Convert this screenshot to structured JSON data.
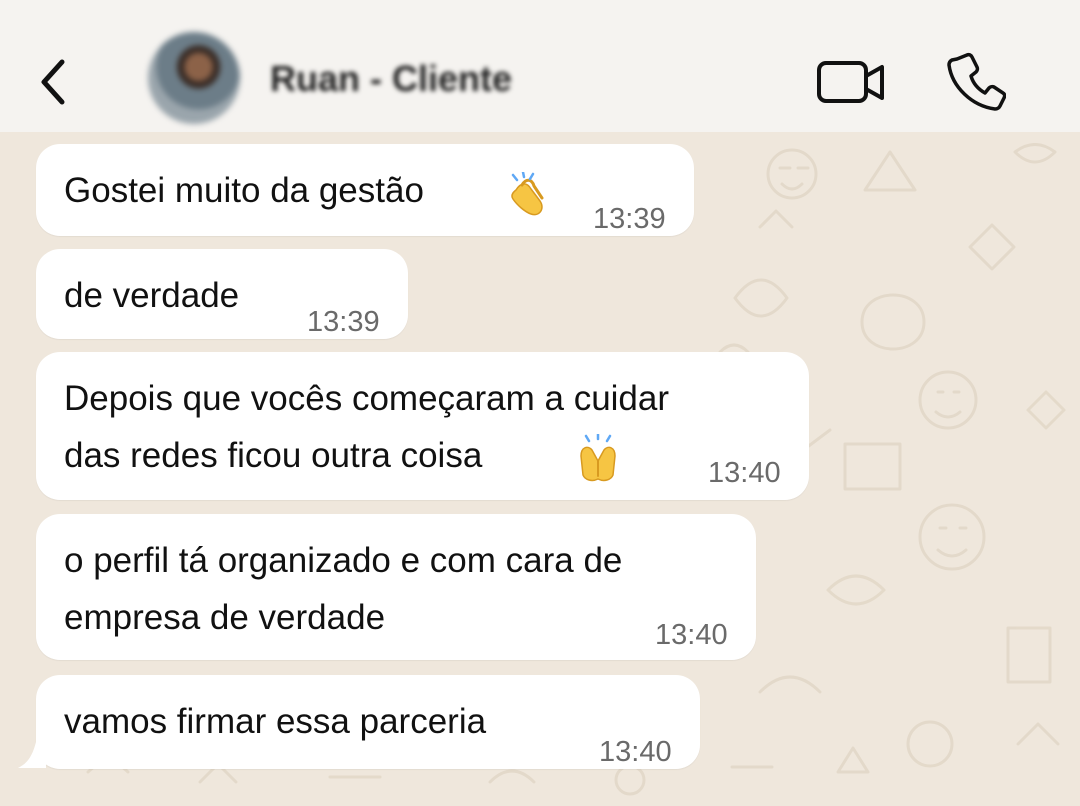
{
  "header": {
    "contact_name": "Ruan - Cliente"
  },
  "messages": [
    {
      "text": "Gostei muito da gestão",
      "time": "13:39",
      "emoji": "clapping-hands"
    },
    {
      "text": "de verdade",
      "time": "13:39"
    },
    {
      "lines": [
        "Depois que vocês começaram a cuidar",
        "das redes ficou outra coisa"
      ],
      "time": "13:40",
      "emoji": "raising-hands"
    },
    {
      "lines": [
        "o perfil tá organizado e com cara de",
        "empresa de verdade"
      ],
      "time": "13:40"
    },
    {
      "text": "vamos firmar essa parceria",
      "time": "13:40"
    }
  ],
  "icons": {
    "back": "chevron-left-icon",
    "video": "video-camera-icon",
    "call": "phone-icon"
  }
}
